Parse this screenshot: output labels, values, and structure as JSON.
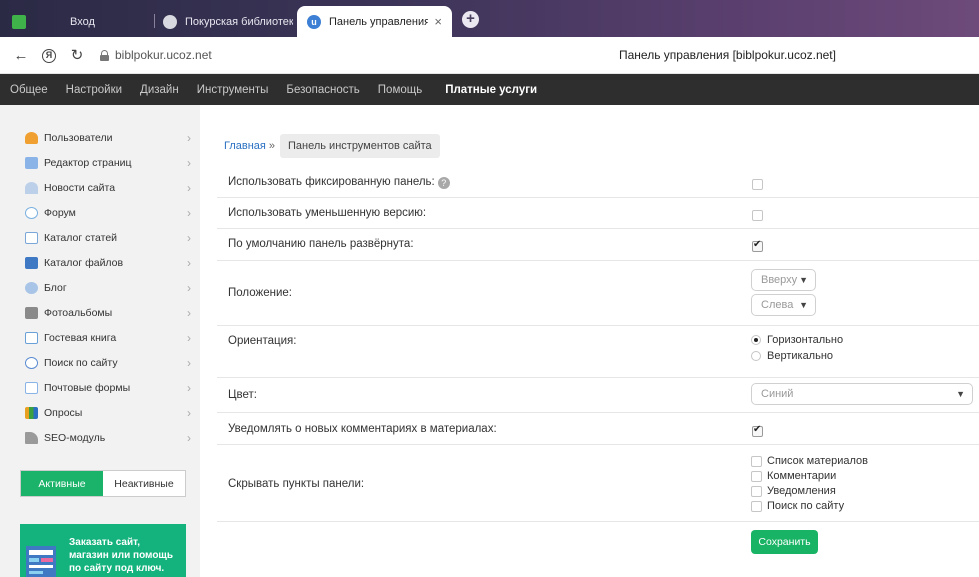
{
  "browser": {
    "tabs": [
      {
        "label": "Вход",
        "icon": "green-square-icon"
      },
      {
        "label": "Покурская библиотека - г",
        "icon": "globe-icon"
      },
      {
        "label": "Панель управления [bib",
        "icon": "ucoz-icon",
        "active": true
      }
    ],
    "url": "biblpokur.ucoz.net",
    "page_title": "Панель управления [biblpokur.ucoz.net]"
  },
  "topmenu": {
    "items": [
      "Общее",
      "Настройки",
      "Дизайн",
      "Инструменты",
      "Безопасность",
      "Помощь"
    ],
    "paid": "Платные услуги"
  },
  "sidebar": {
    "items": [
      {
        "label": "Пользователи",
        "icon": "user-icon",
        "color": "#f0a030"
      },
      {
        "label": "Редактор страниц",
        "icon": "page-icon",
        "color": "#8ab4e8"
      },
      {
        "label": "Новости сайта",
        "icon": "news-icon",
        "color": "#8fb0d8"
      },
      {
        "label": "Форум",
        "icon": "forum-icon",
        "color": "#7ab0e0"
      },
      {
        "label": "Каталог статей",
        "icon": "articles-icon",
        "color": "#7aa6d8"
      },
      {
        "label": "Каталог файлов",
        "icon": "files-icon",
        "color": "#3f79c4"
      },
      {
        "label": "Блог",
        "icon": "blog-icon",
        "color": "#7aa6d8"
      },
      {
        "label": "Фотоальбомы",
        "icon": "photo-icon",
        "color": "#8a8a8a"
      },
      {
        "label": "Гостевая книга",
        "icon": "book-icon",
        "color": "#6aa0d8"
      },
      {
        "label": "Поиск по сайту",
        "icon": "search-icon",
        "color": "#5a8ad0"
      },
      {
        "label": "Почтовые формы",
        "icon": "mail-icon",
        "color": "#8ab4e8"
      },
      {
        "label": "Опросы",
        "icon": "poll-icon",
        "color": "#3aa040"
      },
      {
        "label": "SEO-модуль",
        "icon": "seo-icon",
        "color": "#8a8a8a"
      }
    ],
    "toggle": {
      "active": "Активные",
      "inactive": "Неактивные"
    },
    "promo": {
      "line1": "Заказать сайт,",
      "line2": "магазин или помощь",
      "line3": "по сайту под ключ."
    }
  },
  "breadcrumb": {
    "home": "Главная",
    "sep": "»",
    "current": "Панель инструментов сайта"
  },
  "settings": {
    "fixed_panel": {
      "label": "Использовать фиксированную панель:",
      "help": "?",
      "checked": false
    },
    "reduced": {
      "label": "Использовать уменьшенную версию:",
      "checked": false
    },
    "expanded": {
      "label": "По умолчанию панель развёрнута:",
      "checked": true
    },
    "position": {
      "label": "Положение:",
      "vertical": "Вверху",
      "horizontal": "Слева"
    },
    "orientation": {
      "label": "Ориентация:",
      "options": [
        "Горизонтально",
        "Вертикально"
      ],
      "selected": "Горизонтально"
    },
    "color": {
      "label": "Цвет:",
      "value": "Синий"
    },
    "notify": {
      "label": "Уведомлять о новых комментариях в материалах:",
      "checked": true
    },
    "hide": {
      "label": "Скрывать пункты панели:",
      "items": [
        "Список материалов",
        "Комментарии",
        "Уведомления",
        "Поиск по сайту"
      ]
    }
  },
  "save_label": "Сохранить",
  "colors": {
    "accent": "#18b364",
    "menu_bg": "#2e2e2e",
    "link": "#2a70c2"
  }
}
